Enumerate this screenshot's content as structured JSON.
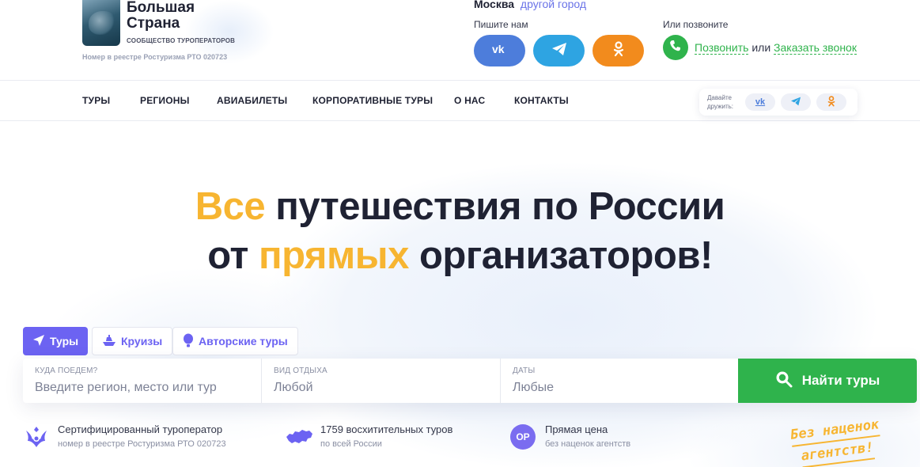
{
  "brand": {
    "title_line1": "Большая",
    "title_line2": "Страна",
    "subtitle": "СООБЩЕСТВО ТУРОПЕРАТОРОВ",
    "registry": "Номер в реестре Ростуризма РТО 020723"
  },
  "location": {
    "city": "Москва",
    "change_link": "другой город"
  },
  "contact": {
    "write_label": "Пишите нам",
    "call_label": "Или позвоните",
    "call_link": "Позвонить",
    "or_text": "или",
    "order_link": "Заказать звонок"
  },
  "nav": {
    "items": [
      "ТУРЫ",
      "РЕГИОНЫ",
      "АВИАБИЛЕТЫ",
      "КОРПОРАТИВНЫЕ ТУРЫ",
      "О НАС",
      "КОНТАКТЫ"
    ],
    "friends_label_1": "Давайте",
    "friends_label_2": "дружить:"
  },
  "hero": {
    "line1_highlight": "Все",
    "line1_rest": " путешествия по России",
    "line2_start": "от ",
    "line2_highlight": "прямых",
    "line2_end": " организаторов!"
  },
  "tabs": [
    {
      "label": "Туры",
      "icon": "send-icon",
      "active": true
    },
    {
      "label": "Круизы",
      "icon": "ship-icon",
      "active": false
    },
    {
      "label": "Авторские туры",
      "icon": "balloon-icon",
      "active": false
    }
  ],
  "search": {
    "destination": {
      "label": "КУДА ПОЕДЕМ?",
      "placeholder": "Введите регион, место или тур"
    },
    "type": {
      "label": "ВИД ОТДЫХА",
      "value": "Любой"
    },
    "dates": {
      "label": "ДАТЫ",
      "value": "Любые"
    },
    "button": "Найти туры"
  },
  "features": [
    {
      "title": "Сертифицированный туроператор",
      "sub": "номер в реестре Ростуризма РТО 020723",
      "icon": "emblem-icon"
    },
    {
      "title": "1759 восхитительных туров",
      "sub": "по всей России",
      "icon": "russia-map-icon"
    },
    {
      "title": "Прямая цена",
      "sub": "без наценок агентств",
      "icon": "op-badge-icon",
      "badge": "ОР"
    }
  ],
  "stamp": {
    "line1": "Без наценок",
    "line2": "агентств!"
  },
  "colors": {
    "accent": "#6c63f2",
    "green": "#2fb34c",
    "yellow": "#f7b531",
    "dark": "#1f2233"
  }
}
